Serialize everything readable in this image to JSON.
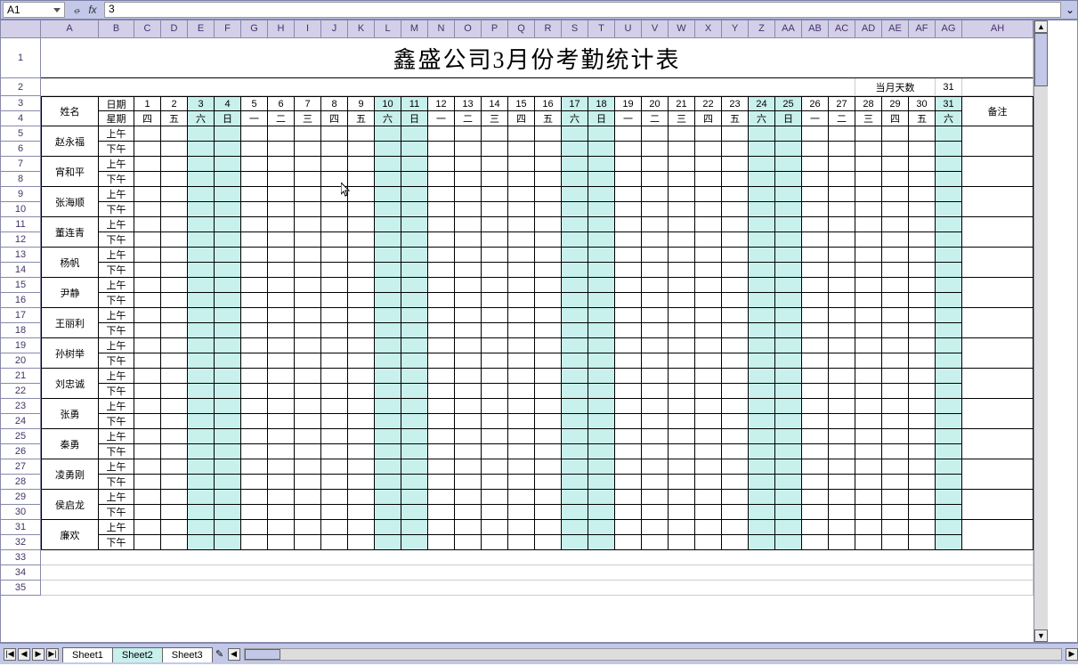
{
  "formula_bar": {
    "name_box": "A1",
    "cancel": "✕",
    "check": "✓",
    "fx": "fx",
    "value": "3",
    "expand": "⌄"
  },
  "columns": [
    "A",
    "B",
    "C",
    "D",
    "E",
    "F",
    "G",
    "H",
    "I",
    "J",
    "K",
    "L",
    "M",
    "N",
    "O",
    "P",
    "Q",
    "R",
    "S",
    "T",
    "U",
    "V",
    "W",
    "X",
    "Y",
    "Z",
    "AA",
    "AB",
    "AC",
    "AD",
    "AE",
    "AF",
    "AG",
    "AH"
  ],
  "row_numbers": [
    1,
    2,
    3,
    4,
    5,
    6,
    7,
    8,
    9,
    10,
    11,
    12,
    13,
    14,
    15,
    16,
    17,
    18,
    19,
    20,
    21,
    22,
    23,
    24,
    25,
    26,
    27,
    28,
    29,
    30,
    31,
    32,
    33,
    34,
    35
  ],
  "title": "鑫盛公司3月份考勤统计表",
  "meta": {
    "label": "当月天数",
    "value": "31"
  },
  "attendance_header": {
    "name_label": "姓名",
    "date_label": "日期",
    "weekday_label": "星期",
    "remark_label": "备注",
    "days": [
      1,
      2,
      3,
      4,
      5,
      6,
      7,
      8,
      9,
      10,
      11,
      12,
      13,
      14,
      15,
      16,
      17,
      18,
      19,
      20,
      21,
      22,
      23,
      24,
      25,
      26,
      27,
      28,
      29,
      30,
      31
    ],
    "weekdays": [
      "四",
      "五",
      "六",
      "日",
      "一",
      "二",
      "三",
      "四",
      "五",
      "六",
      "日",
      "一",
      "二",
      "三",
      "四",
      "五",
      "六",
      "日",
      "一",
      "二",
      "三",
      "四",
      "五",
      "六",
      "日",
      "一",
      "二",
      "三",
      "四",
      "五",
      "六"
    ]
  },
  "weekend_days": [
    3,
    4,
    10,
    11,
    17,
    18,
    24,
    25,
    31
  ],
  "periods": {
    "am": "上午",
    "pm": "下午"
  },
  "employees": [
    "赵永福",
    "宵和平",
    "张海顺",
    "董连青",
    "杨帆",
    "尹静",
    "王丽利",
    "孙树举",
    "刘忠诚",
    "张勇",
    "秦勇",
    "凌勇刚",
    "侯启龙",
    "廉欢"
  ],
  "sheets": {
    "s1": "Sheet1",
    "s2": "Sheet2",
    "s3": "Sheet3",
    "new": "✎"
  },
  "chart_data": {
    "type": "table",
    "title": "鑫盛公司3月份考勤统计表",
    "days_in_month": 31,
    "weekday_map": {
      "1": "四",
      "2": "五",
      "3": "六",
      "4": "日",
      "5": "一",
      "6": "二",
      "7": "三",
      "8": "四",
      "9": "五",
      "10": "六",
      "11": "日",
      "12": "一",
      "13": "二",
      "14": "三",
      "15": "四",
      "16": "五",
      "17": "六",
      "18": "日",
      "19": "一",
      "20": "二",
      "21": "三",
      "22": "四",
      "23": "五",
      "24": "六",
      "25": "日",
      "26": "一",
      "27": "二",
      "28": "三",
      "29": "四",
      "30": "五",
      "31": "六"
    },
    "weekend_days": [
      3,
      4,
      10,
      11,
      17,
      18,
      24,
      25,
      31
    ],
    "employees": [
      "赵永福",
      "宵和平",
      "张海顺",
      "董连青",
      "杨帆",
      "尹静",
      "王丽利",
      "孙树举",
      "刘忠诚",
      "张勇",
      "秦勇",
      "凌勇刚",
      "侯启龙",
      "廉欢"
    ],
    "periods": [
      "上午",
      "下午"
    ],
    "remark_column": "备注"
  }
}
